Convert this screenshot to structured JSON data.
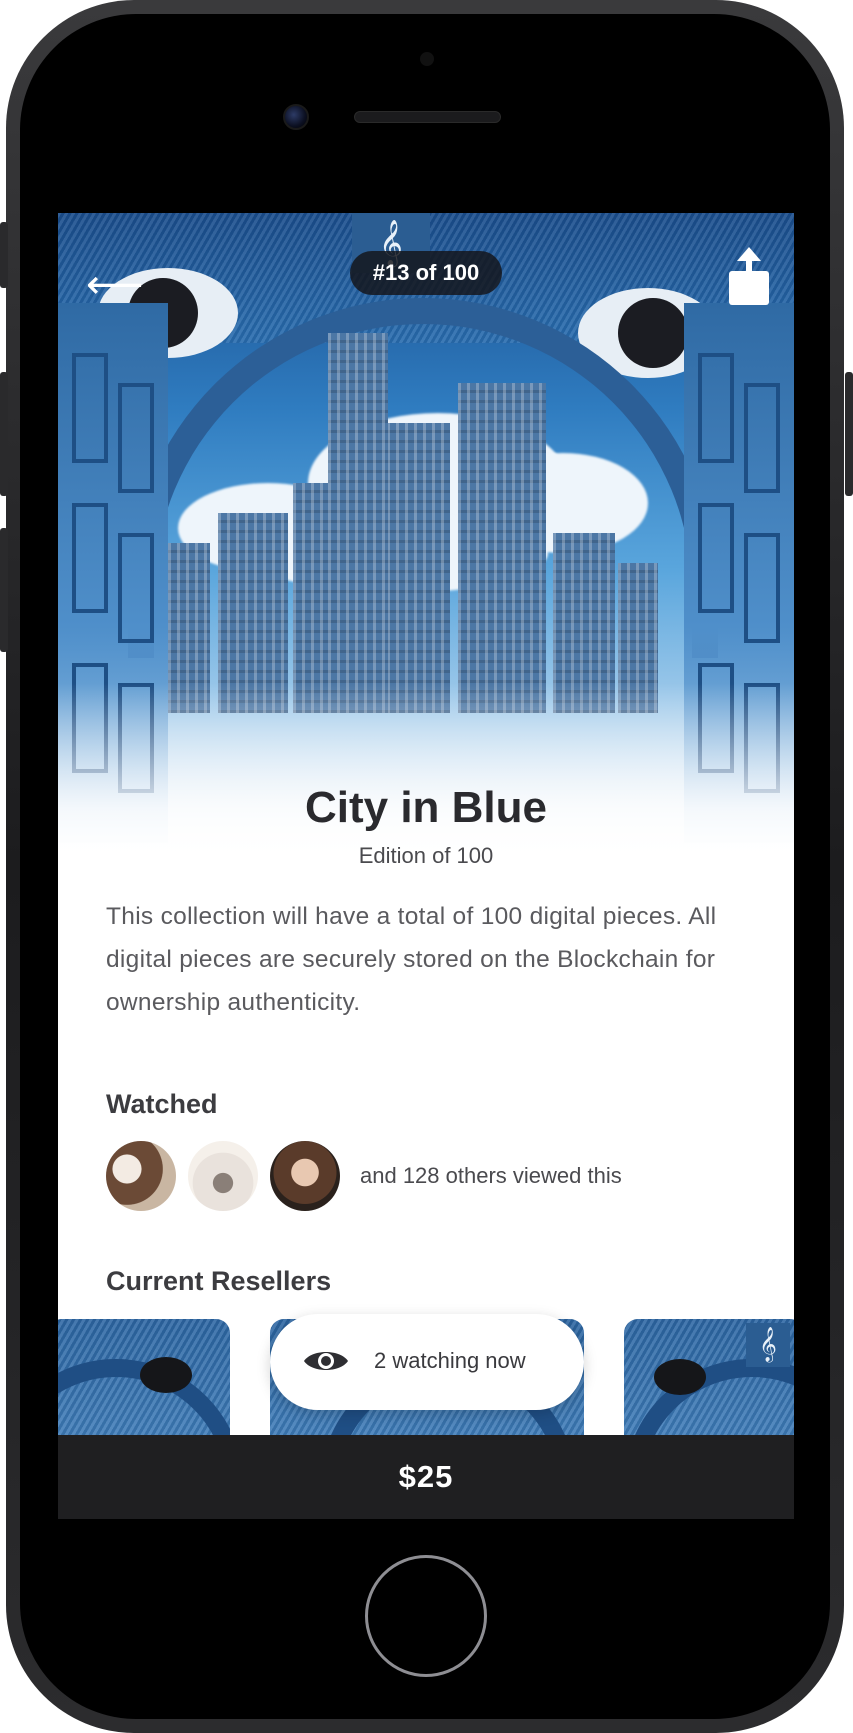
{
  "header": {
    "edition_badge": "#13 of 100"
  },
  "artwork": {
    "title": "City in Blue",
    "edition_text": "Edition of 100",
    "description": "This collection will have a total of 100 digital pieces. All digital pieces are securely stored on the Blockchain for ownership authenticity."
  },
  "watched": {
    "heading": "Watched",
    "others_text": "and 128 others viewed this",
    "avatars": [
      "avatar-1",
      "avatar-2",
      "avatar-3"
    ]
  },
  "resellers": {
    "heading": "Current Resellers",
    "watching_now": "2 watching now"
  },
  "footer": {
    "price": "$25"
  },
  "icons": {
    "back": "back-arrow-icon",
    "share": "share-icon",
    "eye": "eye-icon"
  },
  "colors": {
    "accent_blue": "#2b5d92",
    "price_bar": "#1f1f21",
    "pill_dark": "#141418"
  }
}
